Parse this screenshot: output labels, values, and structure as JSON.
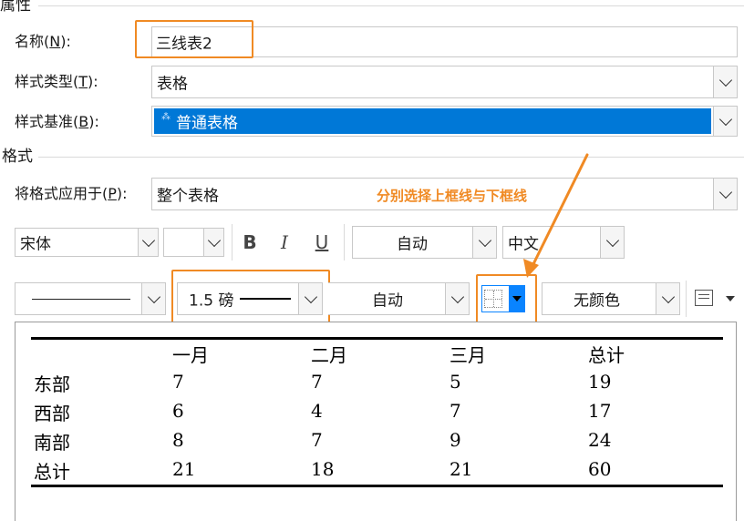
{
  "properties": {
    "section_title": "属性",
    "name_label_main": "名称(",
    "name_label_key": "N",
    "name_label_end": "):",
    "name_value": "三线表2",
    "style_type_label_main": "样式类型(",
    "style_type_label_key": "T",
    "style_type_label_end": "):",
    "style_type_value": "表格",
    "style_based_label_main": "样式基准(",
    "style_based_label_key": "B",
    "style_based_label_end": "):",
    "style_based_value": "普通表格"
  },
  "formatting": {
    "section_title": "格式",
    "apply_label_main": "将格式应用于(",
    "apply_label_key": "P",
    "apply_label_end": "):",
    "apply_value": "整个表格",
    "font_name": "宋体",
    "font_size": "",
    "bold_label": "B",
    "italic_label": "I",
    "underline_label": "U",
    "font_color": "自动",
    "script": "中文",
    "line_weight": "1.5 磅",
    "line_color": "自动",
    "shading": "无颜色"
  },
  "annotation": {
    "text": "分别选择上框线与下框线",
    "color": "#f08a24"
  },
  "preview": {
    "headers": [
      "一月",
      "二月",
      "三月",
      "总计"
    ],
    "rows": [
      {
        "label": "东部",
        "values": [
          "7",
          "7",
          "5",
          "19"
        ]
      },
      {
        "label": "西部",
        "values": [
          "6",
          "4",
          "7",
          "17"
        ]
      },
      {
        "label": "南部",
        "values": [
          "8",
          "7",
          "9",
          "24"
        ]
      },
      {
        "label": "总计",
        "values": [
          "21",
          "18",
          "21",
          "60"
        ]
      }
    ]
  },
  "colors": {
    "accent_orange": "#f08a24",
    "selection_blue": "#0078d7",
    "border_button_blue": "#0a84ff"
  }
}
